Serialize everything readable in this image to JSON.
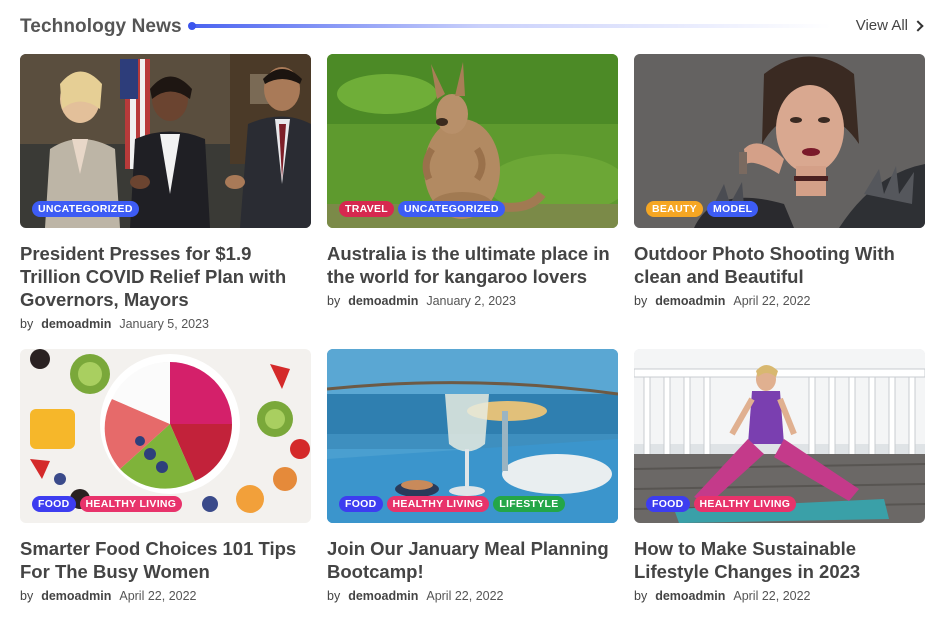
{
  "header": {
    "title": "Technology News",
    "view_all": "View All"
  },
  "colors": {
    "uncategorized": "#3d5cf5",
    "travel": "#d6284f",
    "beauty": "#f5a623",
    "model": "#3d5cf5",
    "food": "#3d3df0",
    "healthy_living": "#e8336b",
    "lifestyle": "#24a648"
  },
  "posts": [
    {
      "title": "President Presses for $1.9 Trillion COVID Relief Plan with Governors, Mayors",
      "by": "by",
      "author": "demoadmin",
      "date": "January 5, 2023",
      "tags": [
        "UNCATEGORIZED"
      ],
      "image": "people-meeting-image"
    },
    {
      "title": "Australia is the ultimate place in the world for kangaroo lovers",
      "by": "by",
      "author": "demoadmin",
      "date": "January 2, 2023",
      "tags": [
        "TRAVEL",
        "UNCATEGORIZED"
      ],
      "image": "kangaroo-image"
    },
    {
      "title": "Outdoor Photo Shooting With clean and Beautiful",
      "by": "by",
      "author": "demoadmin",
      "date": "April 22, 2022",
      "tags": [
        "BEAUTY",
        "MODEL"
      ],
      "image": "model-portrait-image"
    },
    {
      "title": "Smarter Food Choices 101 Tips For The Busy Women",
      "by": "by",
      "author": "demoadmin",
      "date": "April 22, 2022",
      "tags": [
        "FOOD",
        "HEALTHY LIVING"
      ],
      "image": "fruit-bowl-image"
    },
    {
      "title": "Join Our January Meal Planning Bootcamp!",
      "by": "by",
      "author": "demoadmin",
      "date": "April 22, 2022",
      "tags": [
        "FOOD",
        "HEALTHY LIVING",
        "LIFESTYLE"
      ],
      "image": "seaside-table-image"
    },
    {
      "title": "How to Make Sustainable Lifestyle Changes in 2023",
      "by": "by",
      "author": "demoadmin",
      "date": "April 22, 2022",
      "tags": [
        "FOOD",
        "HEALTHY LIVING"
      ],
      "image": "yoga-image"
    }
  ]
}
